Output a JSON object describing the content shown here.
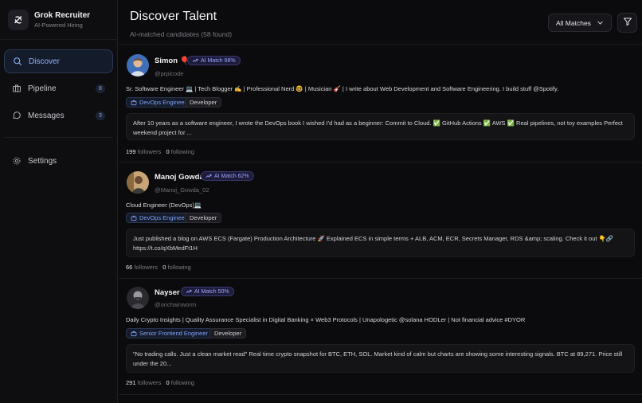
{
  "brand": {
    "title": "Grok Recruiter",
    "subtitle": "AI-Powered Hiring"
  },
  "nav": [
    {
      "label": "Discover",
      "icon": "search-icon",
      "active": true
    },
    {
      "label": "Pipeline",
      "icon": "briefcase-icon",
      "badge": "8"
    },
    {
      "label": "Messages",
      "icon": "message-icon",
      "badge": "3"
    },
    {
      "label": "Settings",
      "icon": "gear-icon"
    }
  ],
  "header": {
    "title": "Discover Talent",
    "subtitle": "AI-matched candidates (58 found)",
    "filter_select": "All Matches"
  },
  "candidates": [
    {
      "name": "Simon",
      "emoji": "🎈",
      "match": "AI Match 68%",
      "handle": "@prplcode",
      "bio": "Sr. Software Engineer 💻 | Tech Blogger ✍️ | Professional Nerd 🤓 | Musician 🎸 | I write about Web Development and Software Engineering. I build stuff @Spotify.",
      "role": "DevOps Engineer",
      "type": "Developer",
      "post": "After 10 years as a software engineer, I wrote the DevOps book I wished I'd had as a beginner: Commit to Cloud. ✅ GitHub Actions ✅ AWS ✅ Real pipelines, not toy examples Perfect weekend project for ...",
      "followers": "199",
      "following": "0"
    },
    {
      "name": "Manoj Gowda",
      "match": "AI Match 62%",
      "handle": "@Manoj_Gowda_02",
      "bio": "Cloud Engineer (DevOps)💻",
      "role": "DevOps Engineer",
      "type": "Developer",
      "post": "Just published a blog on AWS ECS (Fargate) Production Architecture 🚀 Explained ECS in simple terms + ALB, ACM, ECR, Secrets Manager, RDS &amp; scaling. Check it out 👇🔗 https://t.co/qXbMedFt1H",
      "followers": "66",
      "following": "0"
    },
    {
      "name": "Nayser",
      "match": "AI Match 50%",
      "handle": "@onchainworm",
      "bio": "Daily Crypto Insights | Quality Assurance Specialist in Digital Banking × Web3 Protocols | Unapologetic @solana HODLer | Not financial advice #DYOR",
      "role": "Senior Frontend Engineer",
      "type": "Developer",
      "post": "\"No trading calls. Just a clean market read\" Real time crypto snapshot for BTC, ETH, SOL. Market kind of calm but charts are showing some interesting signals. BTC at 89,271. Price still under the 20...",
      "followers": "291",
      "following": "0"
    }
  ],
  "labels": {
    "followers": "followers",
    "following": "following"
  }
}
